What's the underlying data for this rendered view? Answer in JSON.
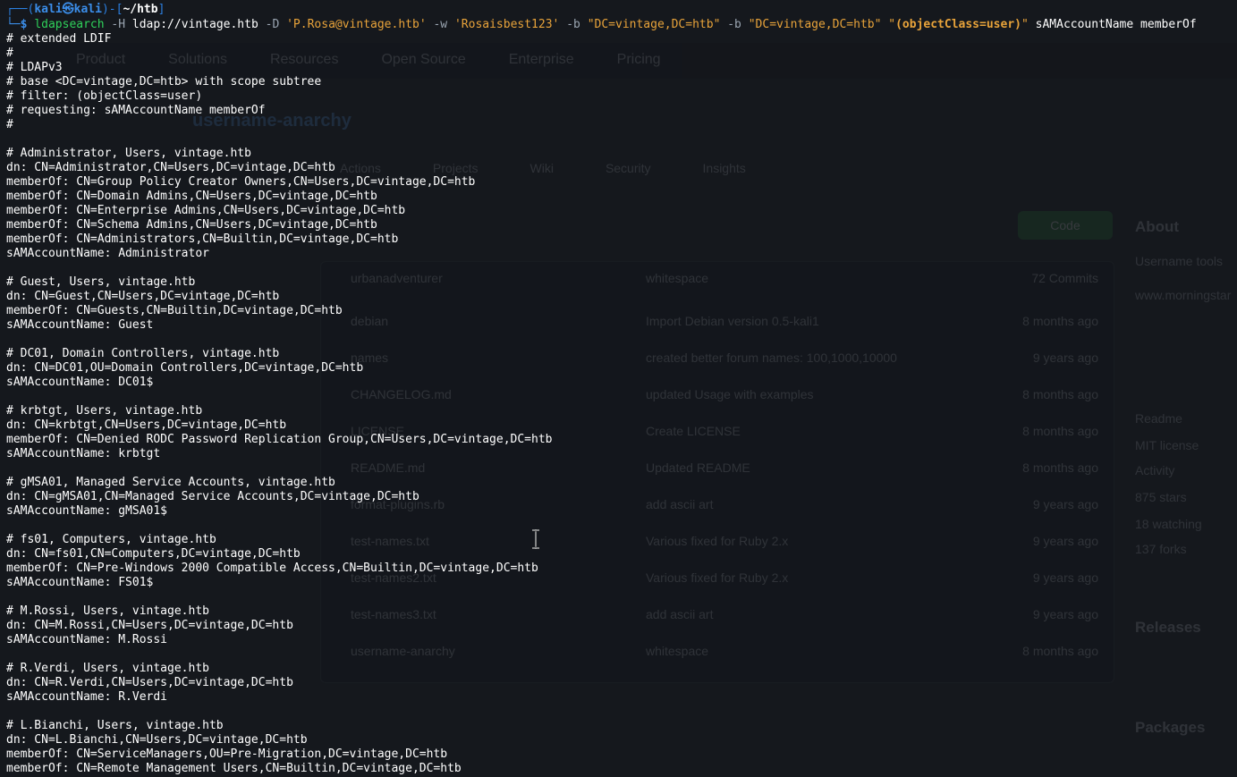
{
  "ghost_page": {
    "nav": [
      "Product",
      "Solutions",
      "Resources",
      "Open Source",
      "Enterprise",
      "Pricing"
    ],
    "repo_title": "username-anarchy",
    "tabs": [
      "Actions",
      "Projects",
      "Wiki",
      "Security",
      "Insights"
    ],
    "code_button": "Code",
    "files": [
      {
        "name": "urbanadventurer",
        "msg": "whitespace",
        "time": "72 Commits"
      },
      {
        "name": "debian",
        "msg": "Import Debian version 0.5-kali1",
        "time": "8 months ago"
      },
      {
        "name": "names",
        "msg": "created better forum names: 100,1000,10000",
        "time": "9 years ago"
      },
      {
        "name": "CHANGELOG.md",
        "msg": "updated Usage with examples",
        "time": "8 months ago"
      },
      {
        "name": "LICENSE",
        "msg": "Create LICENSE",
        "time": "8 months ago"
      },
      {
        "name": "README.md",
        "msg": "Updated README",
        "time": "8 months ago"
      },
      {
        "name": "format-plugins.rb",
        "msg": "add ascii art",
        "time": "9 years ago"
      },
      {
        "name": "test-names.txt",
        "msg": "Various fixed for Ruby 2.x",
        "time": "9 years ago"
      },
      {
        "name": "test-names2.txt",
        "msg": "Various fixed for Ruby 2.x",
        "time": "9 years ago"
      },
      {
        "name": "test-names3.txt",
        "msg": "add ascii art",
        "time": "9 years ago"
      },
      {
        "name": "username-anarchy",
        "msg": "whitespace",
        "time": "8 months ago"
      }
    ],
    "sidebar": [
      "About",
      "Username tools",
      "www.morningstar",
      "Readme",
      "MIT license",
      "Activity",
      "875 stars",
      "18 watching",
      "137 forks",
      "Releases",
      "Packages"
    ]
  },
  "prompt": {
    "prefix": "┌──(",
    "user": "kali",
    "sep": "㉿",
    "host": "kali",
    "mid": ")-[",
    "dir": "~/htb",
    "suffix": "]",
    "arrow": "└─$"
  },
  "command": {
    "bin": "ldapsearch",
    "flag_h": "-H",
    "uri": "ldap://vintage.htb",
    "flag_D": "-D",
    "bind_dn": "'P.Rosa@vintage.htb'",
    "flag_w": "-w",
    "password": "'Rosaisbest123'",
    "flag_b1": "-b",
    "base1": "\"DC=vintage,DC=htb\"",
    "flag_b2": "-b",
    "base2": "\"DC=vintage,DC=htb\"",
    "filter_open": "\"",
    "filter": "(objectClass=user)",
    "filter_close": "\"",
    "attrs": "sAMAccountName memberOf"
  },
  "output_lines": [
    "# extended LDIF",
    "#",
    "# LDAPv3",
    "# base <DC=vintage,DC=htb> with scope subtree",
    "# filter: (objectClass=user)",
    "# requesting: sAMAccountName memberOf",
    "#",
    "",
    "# Administrator, Users, vintage.htb",
    "dn: CN=Administrator,CN=Users,DC=vintage,DC=htb",
    "memberOf: CN=Group Policy Creator Owners,CN=Users,DC=vintage,DC=htb",
    "memberOf: CN=Domain Admins,CN=Users,DC=vintage,DC=htb",
    "memberOf: CN=Enterprise Admins,CN=Users,DC=vintage,DC=htb",
    "memberOf: CN=Schema Admins,CN=Users,DC=vintage,DC=htb",
    "memberOf: CN=Administrators,CN=Builtin,DC=vintage,DC=htb",
    "sAMAccountName: Administrator",
    "",
    "# Guest, Users, vintage.htb",
    "dn: CN=Guest,CN=Users,DC=vintage,DC=htb",
    "memberOf: CN=Guests,CN=Builtin,DC=vintage,DC=htb",
    "sAMAccountName: Guest",
    "",
    "# DC01, Domain Controllers, vintage.htb",
    "dn: CN=DC01,OU=Domain Controllers,DC=vintage,DC=htb",
    "sAMAccountName: DC01$",
    "",
    "# krbtgt, Users, vintage.htb",
    "dn: CN=krbtgt,CN=Users,DC=vintage,DC=htb",
    "memberOf: CN=Denied RODC Password Replication Group,CN=Users,DC=vintage,DC=htb",
    "sAMAccountName: krbtgt",
    "",
    "# gMSA01, Managed Service Accounts, vintage.htb",
    "dn: CN=gMSA01,CN=Managed Service Accounts,DC=vintage,DC=htb",
    "sAMAccountName: gMSA01$",
    "",
    "# fs01, Computers, vintage.htb",
    "dn: CN=fs01,CN=Computers,DC=vintage,DC=htb",
    "memberOf: CN=Pre-Windows 2000 Compatible Access,CN=Builtin,DC=vintage,DC=htb",
    "sAMAccountName: FS01$",
    "",
    "# M.Rossi, Users, vintage.htb",
    "dn: CN=M.Rossi,CN=Users,DC=vintage,DC=htb",
    "sAMAccountName: M.Rossi",
    "",
    "# R.Verdi, Users, vintage.htb",
    "dn: CN=R.Verdi,CN=Users,DC=vintage,DC=htb",
    "sAMAccountName: R.Verdi",
    "",
    "# L.Bianchi, Users, vintage.htb",
    "dn: CN=L.Bianchi,CN=Users,DC=vintage,DC=htb",
    "memberOf: CN=ServiceManagers,OU=Pre-Migration,DC=vintage,DC=htb",
    "memberOf: CN=Remote Management Users,CN=Builtin,DC=vintage,DC=htb"
  ]
}
